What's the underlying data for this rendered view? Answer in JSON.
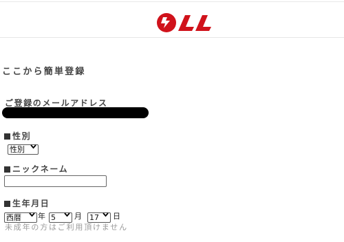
{
  "header": {
    "logo_alt": "LL",
    "brand_color": "#d0121b"
  },
  "page": {
    "title": "ここから簡単登録"
  },
  "email": {
    "label": "ご登録のメールアドレス"
  },
  "gender": {
    "label": "性別",
    "selected": "性別"
  },
  "nickname": {
    "label": "ニックネーム",
    "value": ""
  },
  "birthday": {
    "label": "生年月日",
    "era_selected": "西暦",
    "year_unit": "年",
    "month_selected": "5",
    "month_unit": "月",
    "day_selected": "17",
    "day_unit": "日",
    "note": "未成年の方はご利用頂けません"
  }
}
